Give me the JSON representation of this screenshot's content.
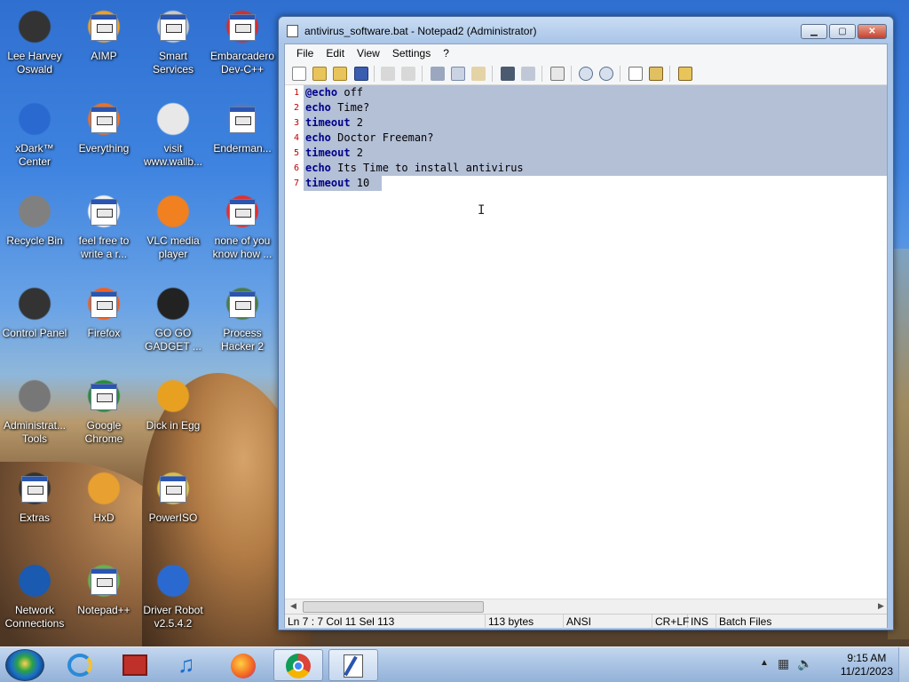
{
  "desktop": {
    "icons": [
      {
        "label": "Lee Harvey Oswald",
        "icon": "character-icon"
      },
      {
        "label": "AIMP",
        "icon": "aimp-icon"
      },
      {
        "label": "Smart Services",
        "icon": "gear-icon"
      },
      {
        "label": "Embarcadero Dev-C++",
        "icon": "devcpp-icon"
      },
      {
        "label": "xDark™ Center",
        "icon": "xdark-icon"
      },
      {
        "label": "Everything",
        "icon": "search-icon"
      },
      {
        "label": "visit www.wallb...",
        "icon": "document-icon"
      },
      {
        "label": "Enderman...",
        "icon": "app-icon"
      },
      {
        "label": "Recycle Bin",
        "icon": "recycle-bin-icon"
      },
      {
        "label": "feel free to write a r...",
        "icon": "document-icon"
      },
      {
        "label": "VLC media player",
        "icon": "vlc-icon"
      },
      {
        "label": "none of you know how ...",
        "icon": "app-icon"
      },
      {
        "label": "Control Panel",
        "icon": "control-panel-icon"
      },
      {
        "label": "Firefox",
        "icon": "firefox-icon"
      },
      {
        "label": "GO GO GADGET ...",
        "icon": "gadget-icon"
      },
      {
        "label": "Process Hacker 2",
        "icon": "process-hacker-icon"
      },
      {
        "label": "Administrat... Tools",
        "icon": "admin-tools-icon"
      },
      {
        "label": "Google Chrome",
        "icon": "chrome-icon"
      },
      {
        "label": "Dick in Egg",
        "icon": "app-icon"
      },
      {
        "label": "Extras",
        "icon": "folder-icon"
      },
      {
        "label": "HxD",
        "icon": "hxd-icon"
      },
      {
        "label": "PowerISO",
        "icon": "disc-icon"
      },
      {
        "label": "Network Connections",
        "icon": "network-icon"
      },
      {
        "label": "Notepad++",
        "icon": "notepadpp-icon"
      },
      {
        "label": "Driver Robot v2.5.4.2",
        "icon": "driver-robot-icon"
      }
    ]
  },
  "window": {
    "title": "antivirus_software.bat - Notepad2 (Administrator)",
    "min_label": "▁",
    "max_label": "▢",
    "close_label": "✕",
    "menu": [
      "File",
      "Edit",
      "View",
      "Settings",
      "?"
    ],
    "lines": [
      {
        "num": "1",
        "kw": "@echo",
        "rest": " off"
      },
      {
        "num": "2",
        "kw": "echo",
        "rest": " Time?"
      },
      {
        "num": "3",
        "kw": "timeout",
        "rest": " 2"
      },
      {
        "num": "4",
        "kw": "echo",
        "rest": " Doctor Freeman?"
      },
      {
        "num": "5",
        "kw": "timeout",
        "rest": " 2"
      },
      {
        "num": "6",
        "kw": "echo",
        "rest": " Its Time to install antivirus"
      },
      {
        "num": "7",
        "kw": "timeout",
        "rest": " 10"
      }
    ],
    "status": {
      "position": "Ln 7 : 7   Col 11   Sel 113",
      "size": "113 bytes",
      "encoding": "ANSI",
      "eol": "CR+LF",
      "mode": "INS",
      "scheme": "Batch Files"
    }
  },
  "taskbar": {
    "time": "9:15 AM",
    "date": "11/21/2023"
  }
}
